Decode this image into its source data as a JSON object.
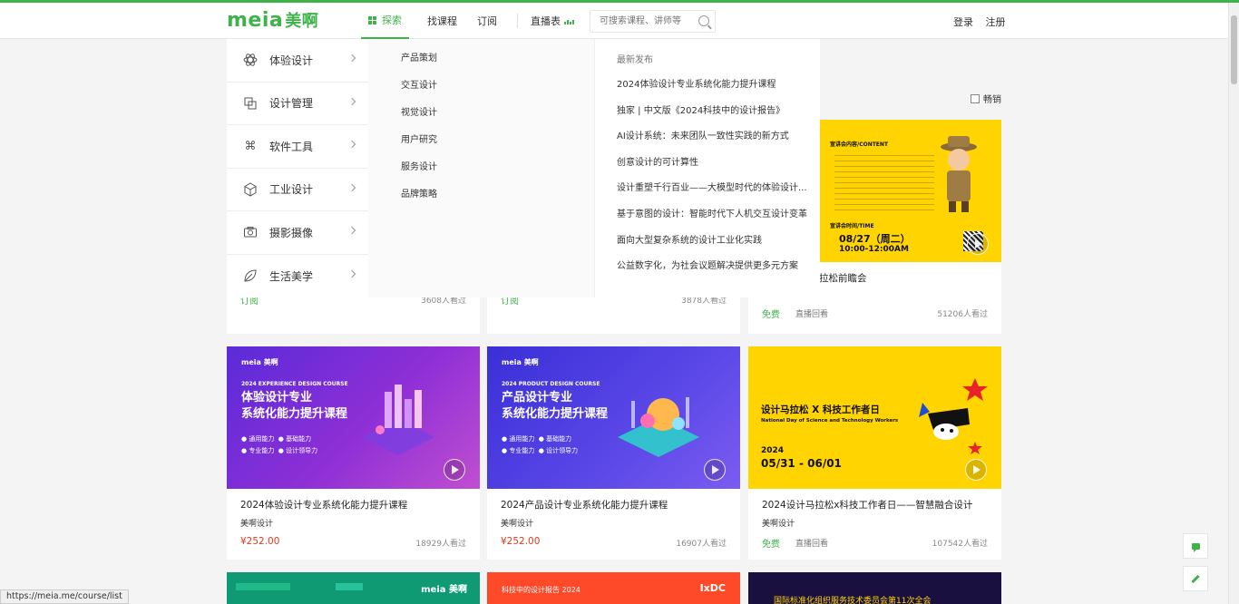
{
  "brand": {
    "logo_text": "meia",
    "logo_cn": "美啊"
  },
  "nav": {
    "items": [
      {
        "label": "探索",
        "active": true
      },
      {
        "label": "找课程"
      },
      {
        "label": "订阅"
      },
      {
        "label": "直播表"
      }
    ],
    "search_placeholder": "可搜索课程、讲师等"
  },
  "auth": {
    "login": "登录",
    "register": "注册"
  },
  "categories": [
    {
      "label": "体验设计",
      "icon": "atom-icon"
    },
    {
      "label": "设计管理",
      "icon": "overlap-squares-icon"
    },
    {
      "label": "软件工具",
      "icon": "command-icon"
    },
    {
      "label": "工业设计",
      "icon": "cube-icon"
    },
    {
      "label": "摄影摄像",
      "icon": "camera-icon"
    },
    {
      "label": "生活美学",
      "icon": "leaf-icon"
    }
  ],
  "subcategories": [
    "产品策划",
    "交互设计",
    "视觉设计",
    "用户研究",
    "服务设计",
    "品牌策略"
  ],
  "news": {
    "heading": "最新发布",
    "items": [
      "2024体验设计专业系统化能力提升课程",
      "独家 | 中文版《2024科技中的设计报告》",
      "AI设计系统：未来团队一致性实践的新方式",
      "创意设计的可计算性",
      "设计重塑千行百业——大模型时代的体验设计...",
      "基于意图的设计：智能时代下人机交互设计变革",
      "面向大型复杂系统的设计工业化实践",
      "公益数字化，为社会议题解决提供更多元方案"
    ]
  },
  "filter": {
    "label": "畅销"
  },
  "row1": [
    {
      "title": "",
      "tag": "订阅",
      "views": "3608人看过"
    },
    {
      "title": "",
      "tag": "订阅",
      "views": "3878人看过"
    },
    {
      "title": "拉松前瞻会",
      "tag": "免费",
      "replay": "直播回看",
      "views": "51206人看过",
      "poster": {
        "content_head": "宣讲会内容/CONTENT",
        "time_head": "宣讲会时间/TIME",
        "date": "08/27（周二）",
        "time": "10:00-12:00AM"
      }
    }
  ],
  "row2": [
    {
      "title": "2024体验设计专业系统化能力提升课程",
      "org": "美啊设计",
      "price": "¥252.00",
      "views": "18929人看过",
      "poster": {
        "brand": "meia 美啊",
        "en": "2024 EXPERIENCE DESIGN COURSE",
        "cn_line1": "体验设计专业",
        "cn_line2": "系统化能力提升课程",
        "bullets": [
          "通用能力",
          "基础能力",
          "专业能力",
          "设计领导力"
        ]
      }
    },
    {
      "title": "2024产品设计专业系统化能力提升课程",
      "org": "美啊设计",
      "price": "¥252.00",
      "views": "16907人看过",
      "poster": {
        "brand": "meia 美啊",
        "en": "2024 PRODUCT DESIGN COURSE",
        "cn_line1": "产品设计专业",
        "cn_line2": "系统化能力提升课程",
        "bullets": [
          "通用能力",
          "基础能力",
          "专业能力",
          "设计领导力"
        ]
      }
    },
    {
      "title": "2024设计马拉松x科技工作者日——智慧融合设计",
      "org": "美啊设计",
      "tag": "免费",
      "replay": "直播回看",
      "views": "107542人看过",
      "poster": {
        "title": "设计马拉松 X 科技工作者日",
        "en": "National Day of Science and Technology Workers",
        "year": "2024",
        "date": "05/31 - 06/01"
      }
    }
  ],
  "row3": [
    {
      "brand": "meia 美啊"
    },
    {
      "text": "科技中的设计报告 2024",
      "brand": "IxDC"
    },
    {
      "text": "国际标准化组织服务技术委员会第11次全会"
    }
  ],
  "status_url": "https://meia.me/course/list",
  "colors": {
    "accent": "#3fb24a",
    "price": "#e03a1e",
    "yellow": "#ffd400"
  }
}
